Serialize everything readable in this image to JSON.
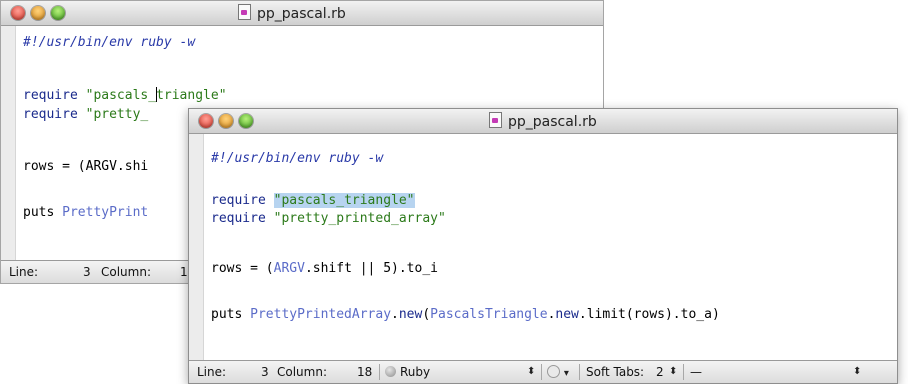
{
  "back_window": {
    "title": "pp_pascal.rb",
    "code": {
      "line1": "#!/usr/bin/env ruby -w",
      "line2_kw": "require",
      "line2_str_a": "\"pascals_",
      "line2_str_b": "triangle\"",
      "line3_kw": "require",
      "line3_str": "\"pretty_",
      "line4": "rows = (ARGV.shi",
      "line5_a": "puts ",
      "line5_cls": "PrettyPrint"
    },
    "status": {
      "line_label": "Line:",
      "line_value": "3",
      "column_label": "Column:",
      "column_value": "1"
    }
  },
  "front_window": {
    "title": "pp_pascal.rb",
    "code": {
      "line1": "#!/usr/bin/env ruby -w",
      "line2_kw": "require",
      "line2_str": "\"pascals_triangle\"",
      "line3_kw": "require",
      "line3_str": "\"pretty_printed_array\"",
      "line4_a": "rows = (",
      "line4_b": "ARGV",
      "line4_c": ".shift || 5).to_i",
      "line5_a": "puts ",
      "line5_b": "PrettyPrintedArray",
      "line5_c": ".",
      "line5_d": "new",
      "line5_e": "(",
      "line5_f": "PascalsTriangle",
      "line5_g": ".",
      "line5_h": "new",
      "line5_i": ".limit(rows).to_a)"
    },
    "status": {
      "line_label": "Line:",
      "line_value": "3",
      "column_label": "Column:",
      "column_value": "18",
      "language": "Ruby",
      "tabs_label": "Soft Tabs:",
      "tabs_value": "2",
      "symbol": "—"
    }
  },
  "icons": {
    "document": "ruby-document-icon",
    "language": "ruby-dot-icon",
    "gear": "gear-menu-icon",
    "stepper": "up-down-arrows-icon"
  }
}
